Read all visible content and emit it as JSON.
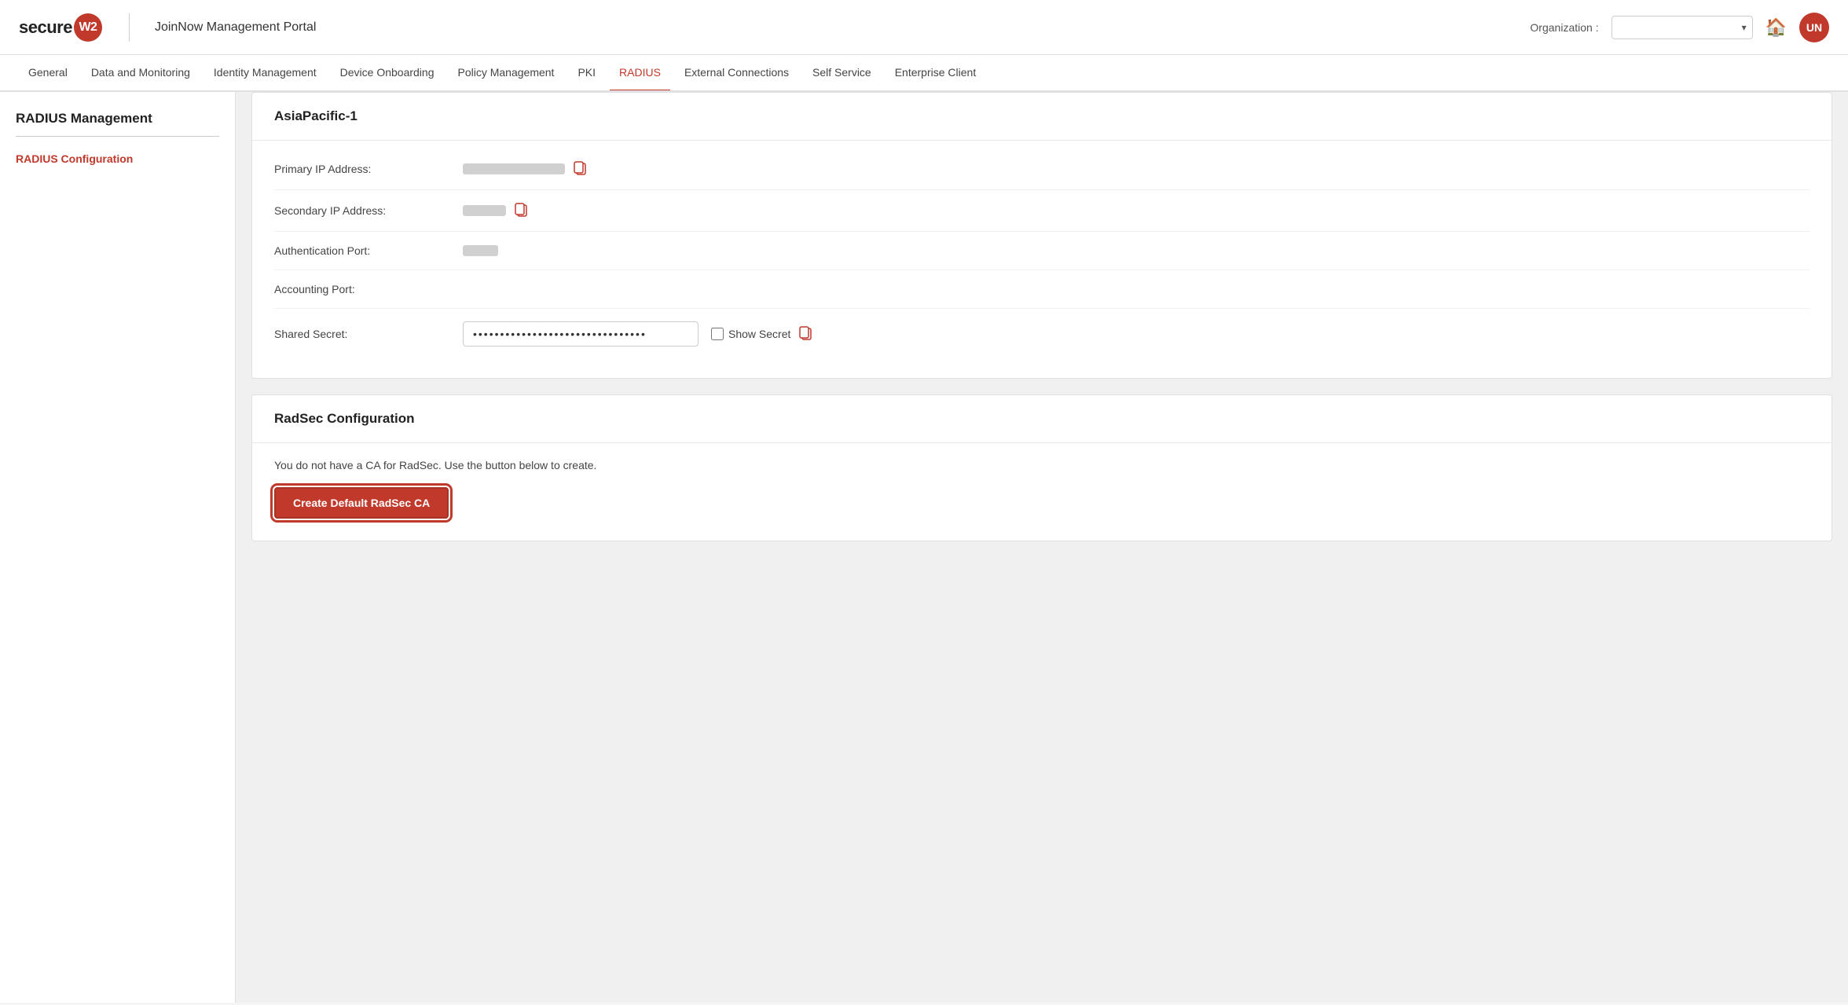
{
  "header": {
    "logo_text_before": "secure",
    "logo_badge": "W2",
    "portal_title": "JoinNow Management Portal",
    "org_label": "Organization :",
    "org_placeholder": "",
    "home_icon": "🏠",
    "user_initials": "UN"
  },
  "nav": {
    "items": [
      {
        "id": "general",
        "label": "General",
        "active": false
      },
      {
        "id": "data-monitoring",
        "label": "Data and Monitoring",
        "active": false
      },
      {
        "id": "identity-management",
        "label": "Identity Management",
        "active": false
      },
      {
        "id": "device-onboarding",
        "label": "Device Onboarding",
        "active": false
      },
      {
        "id": "policy-management",
        "label": "Policy Management",
        "active": false
      },
      {
        "id": "pki",
        "label": "PKI",
        "active": false
      },
      {
        "id": "radius",
        "label": "RADIUS",
        "active": true
      },
      {
        "id": "external-connections",
        "label": "External Connections",
        "active": false
      },
      {
        "id": "self-service",
        "label": "Self Service",
        "active": false
      },
      {
        "id": "enterprise-client",
        "label": "Enterprise Client",
        "active": false
      }
    ]
  },
  "sidebar": {
    "title": "RADIUS Management",
    "links": [
      {
        "id": "radius-config",
        "label": "RADIUS Configuration",
        "active": true
      }
    ]
  },
  "content": {
    "asia_pacific": {
      "section_title": "AsiaPacific-1",
      "fields": [
        {
          "id": "primary-ip",
          "label": "Primary IP Address:",
          "masked_width": 130,
          "has_clipboard": true
        },
        {
          "id": "secondary-ip",
          "label": "Secondary IP Address:",
          "masked_width": 55,
          "has_clipboard": true
        },
        {
          "id": "auth-port",
          "label": "Authentication Port:",
          "masked_width": 45,
          "has_clipboard": false
        },
        {
          "id": "accounting-port",
          "label": "Accounting Port:",
          "masked_width": 0,
          "has_clipboard": false
        },
        {
          "id": "shared-secret",
          "label": "Shared Secret:",
          "secret_value": "••••••••••••••••••••••••••••••••",
          "show_secret_label": "Show Secret",
          "has_clipboard": true
        }
      ]
    },
    "radsec": {
      "section_title": "RadSec Configuration",
      "message": "You do not have a CA for RadSec. Use the button below to create.",
      "create_btn_label": "Create Default RadSec CA"
    }
  }
}
